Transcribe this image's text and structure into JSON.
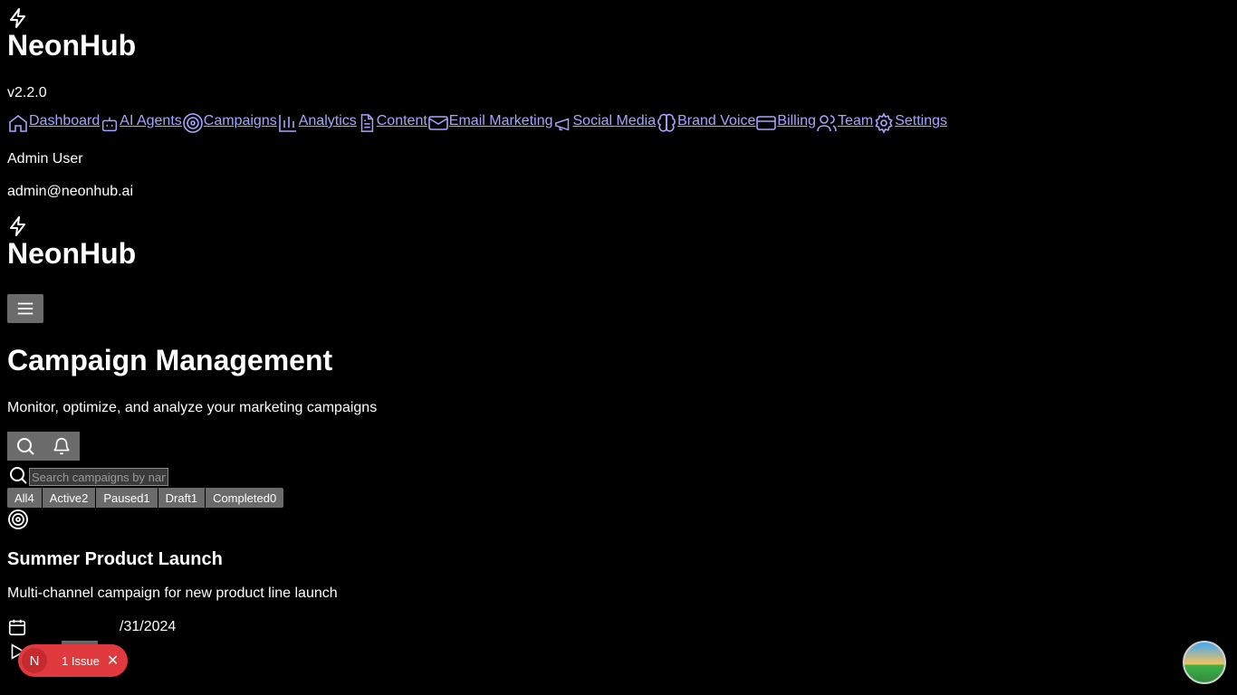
{
  "sidebar": {
    "brand": "NeonHub",
    "version": "v2.2.0",
    "nav": [
      {
        "label": "Dashboard",
        "icon": "home-icon"
      },
      {
        "label": "AI Agents",
        "icon": "bot-icon"
      },
      {
        "label": "Campaigns",
        "icon": "target-icon"
      },
      {
        "label": "Analytics",
        "icon": "bar-chart-icon"
      },
      {
        "label": "Content",
        "icon": "document-icon"
      },
      {
        "label": "Email Marketing",
        "icon": "mail-icon"
      },
      {
        "label": "Social Media",
        "icon": "megaphone-icon"
      },
      {
        "label": "Brand Voice",
        "icon": "brain-icon"
      },
      {
        "label": "Billing",
        "icon": "credit-card-icon"
      },
      {
        "label": "Team",
        "icon": "users-icon"
      },
      {
        "label": "Settings",
        "icon": "gear-icon"
      }
    ],
    "user": {
      "name": "Admin User",
      "email": "admin@neonhub.ai"
    }
  },
  "header": {
    "brand": "NeonHub"
  },
  "page": {
    "title": "Campaign Management",
    "subtitle": "Monitor, optimize, and analyze your marketing campaigns",
    "search_placeholder": "Search campaigns by name..."
  },
  "filters": [
    {
      "label": "All",
      "count": "4"
    },
    {
      "label": "Active",
      "count": "2"
    },
    {
      "label": "Paused",
      "count": "1"
    },
    {
      "label": "Draft",
      "count": "1"
    },
    {
      "label": "Completed",
      "count": "0"
    }
  ],
  "campaign": {
    "name": "Summer Product Launch",
    "description": "Multi-channel campaign for new product line launch",
    "date": "/31/2024"
  },
  "issue_badge": {
    "initial": "N",
    "label": "1 Issue"
  },
  "colors": {
    "link": "#a5a5ff",
    "button_bg": "#6b6b6b",
    "issue_red": "#e03a3e"
  }
}
